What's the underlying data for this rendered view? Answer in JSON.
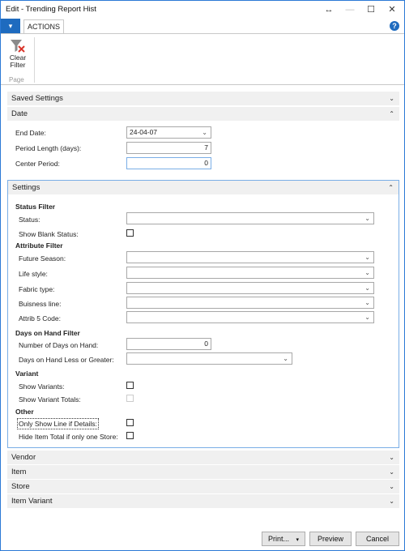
{
  "window": {
    "title": "Edit - Trending Report Hist",
    "controls": [
      "↔",
      "—",
      "☐",
      "✕"
    ]
  },
  "ribbon": {
    "app_menu_glyph": "▾",
    "tab": "ACTIONS",
    "help_glyph": "?",
    "clear_filter_line1": "Clear",
    "clear_filter_line2": "Filter",
    "group": "Page"
  },
  "sections": {
    "saved_settings": "Saved Settings",
    "date": "Date",
    "settings": "Settings",
    "vendor": "Vendor",
    "item": "Item",
    "store": "Store",
    "item_variant": "Item Variant"
  },
  "date": {
    "end_date_label": "End Date:",
    "end_date_value": "24-04-07",
    "period_length_label": "Period Length (days):",
    "period_length_value": "7",
    "center_period_label": "Center Period:",
    "center_period_value": "0"
  },
  "settings": {
    "status_filter": "Status Filter",
    "status_label": "Status:",
    "status_value": "",
    "show_blank_status_label": "Show Blank Status:",
    "attribute_filter": "Attribute Filter",
    "future_season_label": "Future Season:",
    "life_style_label": "Life style:",
    "fabric_type_label": "Fabric type:",
    "buisness_line_label": "Buisness line:",
    "attrib5_label": "Attrib 5 Code:",
    "days_on_hand_filter": "Days on Hand Filter",
    "number_days_label": "Number of Days on Hand:",
    "number_days_value": "0",
    "days_less_greater_label": "Days on Hand Less or Greater:",
    "days_less_greater_value": "",
    "variant": "Variant",
    "show_variants_label": "Show Variants:",
    "show_variant_totals_label": "Show Variant Totals:",
    "other": "Other",
    "only_show_line_label": "Only Show Line if Details:",
    "hide_item_total_label": "Hide Item Total if only one Store:"
  },
  "buttons": {
    "print": "Print...",
    "print_arrow": "▾",
    "preview": "Preview",
    "cancel": "Cancel"
  },
  "chevron_down": "⌄",
  "chevron_up": "⌃",
  "dropdown_glyph": "⌄",
  "colors": {
    "accent": "#1e6bbf",
    "focus_border": "#7aaee6",
    "filter_x": "#d9352b"
  }
}
